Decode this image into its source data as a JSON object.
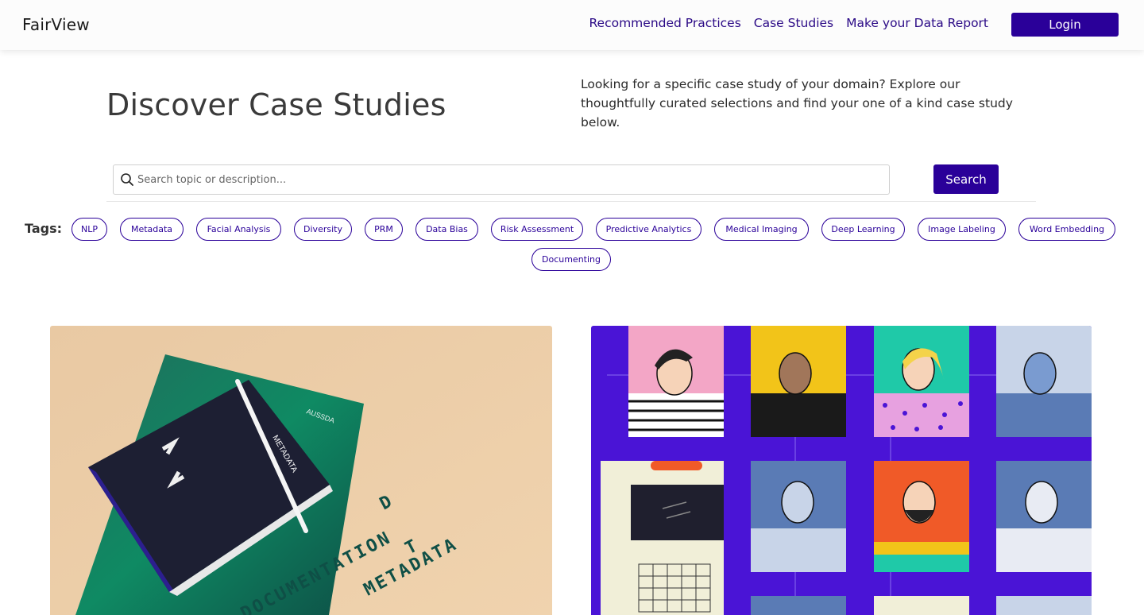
{
  "brand": "FairView",
  "nav": {
    "links": [
      "Recommended Practices",
      "Case Studies",
      "Make your Data Report"
    ],
    "login_label": "Login"
  },
  "hero": {
    "title": "Discover Case Studies",
    "description": "Looking for a specific case study of your domain? Explore our thoughtfully curated selections and find your one of a kind case study below."
  },
  "search": {
    "placeholder": "Search topic or description...",
    "value": "",
    "button_label": "Search"
  },
  "tags": {
    "label": "Tags:",
    "items": [
      "NLP",
      "Metadata",
      "Facial Analysis",
      "Diversity",
      "PRM",
      "Data Bias",
      "Risk Assessment",
      "Predictive Analytics",
      "Medical Imaging",
      "Deep Learning",
      "Image Labeling",
      "Word Embedding",
      "Documenting"
    ]
  },
  "cards": {
    "card1": {
      "image_text": {
        "brand": "AUSSDA",
        "book_title": "METADATA",
        "tiles_line1": "DOCUMENTATION",
        "tiles_line2": "METADATA",
        "tiles_d": "D",
        "tiles_t": "T"
      }
    }
  },
  "colors": {
    "accent": "#2a0099",
    "nav_link": "#2b0a86",
    "card2_bg": "#4a14d6"
  }
}
